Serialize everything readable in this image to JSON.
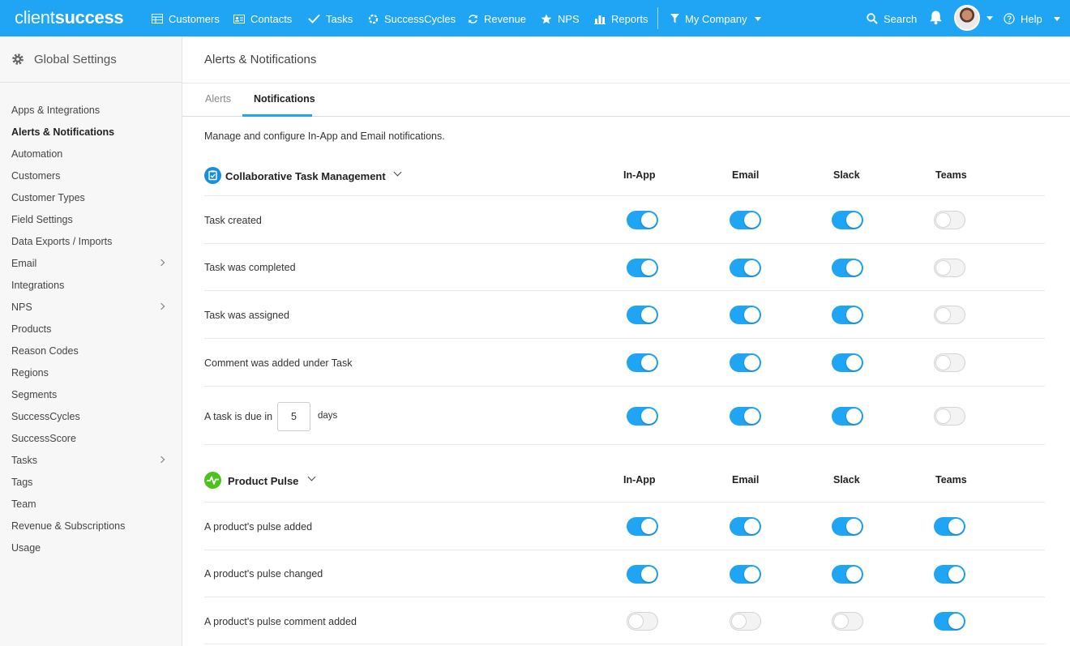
{
  "brand": {
    "logo_light": "client",
    "logo_bold": "success",
    "accent": "#1fa5f4"
  },
  "topnav": {
    "items": [
      {
        "label": "Customers",
        "icon": "table-icon"
      },
      {
        "label": "Contacts",
        "icon": "contact-card-icon"
      },
      {
        "label": "Tasks",
        "icon": "checkmark-icon"
      },
      {
        "label": "SuccessCycles",
        "icon": "cycle-gear-icon"
      },
      {
        "label": "Revenue",
        "icon": "refresh-icon"
      },
      {
        "label": "NPS",
        "icon": "star-icon"
      },
      {
        "label": "Reports",
        "icon": "bar-chart-icon"
      }
    ],
    "company_filter": "My Company",
    "search": "Search",
    "help": "Help"
  },
  "sidebar": {
    "title": "Global Settings",
    "items": [
      {
        "label": "Apps & Integrations",
        "has_children": false,
        "active": false
      },
      {
        "label": "Alerts & Notifications",
        "has_children": false,
        "active": true
      },
      {
        "label": "Automation",
        "has_children": false,
        "active": false
      },
      {
        "label": "Customers",
        "has_children": false,
        "active": false
      },
      {
        "label": "Customer Types",
        "has_children": false,
        "active": false
      },
      {
        "label": "Field Settings",
        "has_children": false,
        "active": false
      },
      {
        "label": "Data Exports / Imports",
        "has_children": false,
        "active": false
      },
      {
        "label": "Email",
        "has_children": true,
        "active": false
      },
      {
        "label": "Integrations",
        "has_children": false,
        "active": false
      },
      {
        "label": "NPS",
        "has_children": true,
        "active": false
      },
      {
        "label": "Products",
        "has_children": false,
        "active": false
      },
      {
        "label": "Reason Codes",
        "has_children": false,
        "active": false
      },
      {
        "label": "Regions",
        "has_children": false,
        "active": false
      },
      {
        "label": "Segments",
        "has_children": false,
        "active": false
      },
      {
        "label": "SuccessCycles",
        "has_children": false,
        "active": false
      },
      {
        "label": "SuccessScore",
        "has_children": false,
        "active": false
      },
      {
        "label": "Tasks",
        "has_children": true,
        "active": false
      },
      {
        "label": "Tags",
        "has_children": false,
        "active": false
      },
      {
        "label": "Team",
        "has_children": false,
        "active": false
      },
      {
        "label": "Revenue & Subscriptions",
        "has_children": false,
        "active": false
      },
      {
        "label": "Usage",
        "has_children": false,
        "active": false
      }
    ]
  },
  "main": {
    "title": "Alerts & Notifications",
    "tabs": [
      {
        "label": "Alerts",
        "active": false
      },
      {
        "label": "Notifications",
        "active": true
      }
    ],
    "intro": "Manage and configure In-App and Email notifications.",
    "columns": [
      "In-App",
      "Email",
      "Slack",
      "Teams"
    ],
    "sections": [
      {
        "title": "Collaborative Task Management",
        "icon": "task-check-icon",
        "icon_color": "#1a8fd8",
        "rows": [
          {
            "label": "Task created",
            "toggles": [
              true,
              true,
              true,
              false
            ]
          },
          {
            "label": "Task was completed",
            "toggles": [
              true,
              true,
              true,
              false
            ]
          },
          {
            "label": "Task was assigned",
            "toggles": [
              true,
              true,
              true,
              false
            ]
          },
          {
            "label": "Comment was added under Task",
            "toggles": [
              true,
              true,
              true,
              false
            ]
          },
          {
            "label": "A task is due in",
            "days_value": "5",
            "days_suffix": "days",
            "toggles": [
              true,
              true,
              true,
              false
            ]
          }
        ]
      },
      {
        "title": "Product Pulse",
        "icon": "pulse-icon",
        "icon_color": "#4cc21a",
        "rows": [
          {
            "label": "A product's pulse added",
            "toggles": [
              true,
              true,
              true,
              true
            ]
          },
          {
            "label": "A product's pulse changed",
            "toggles": [
              true,
              true,
              true,
              true
            ]
          },
          {
            "label": "A product's pulse comment added",
            "toggles": [
              false,
              false,
              false,
              true
            ]
          }
        ]
      }
    ]
  }
}
